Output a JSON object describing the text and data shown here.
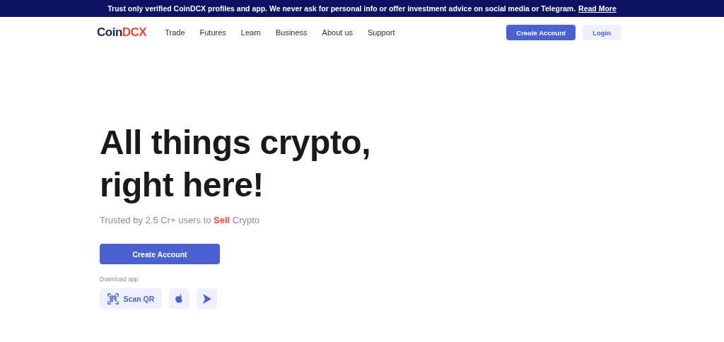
{
  "banner": {
    "text": "Trust only verified CoinDCX profiles and app. We never ask for personal info or offer investment advice on social media or Telegram.",
    "link": "Read More"
  },
  "nav": {
    "logo": {
      "first": "Coin",
      "second": "DCX"
    },
    "items": [
      "Trade",
      "Futures",
      "Learn",
      "Business",
      "About us",
      "Support"
    ],
    "primary_button": "Create Account",
    "secondary_button": "Login"
  },
  "hero": {
    "headline_lines": [
      "All things crypto,",
      "right here!"
    ],
    "subtitle": "Trusted by 2.5 Cr+ users to **Sell** Crypto",
    "cta": "Create Account",
    "download_label": "Download app",
    "apps": [
      {
        "kind": "qr",
        "label": "Scan QR"
      },
      {
        "kind": "apple"
      },
      {
        "kind": "play"
      }
    ]
  }
}
